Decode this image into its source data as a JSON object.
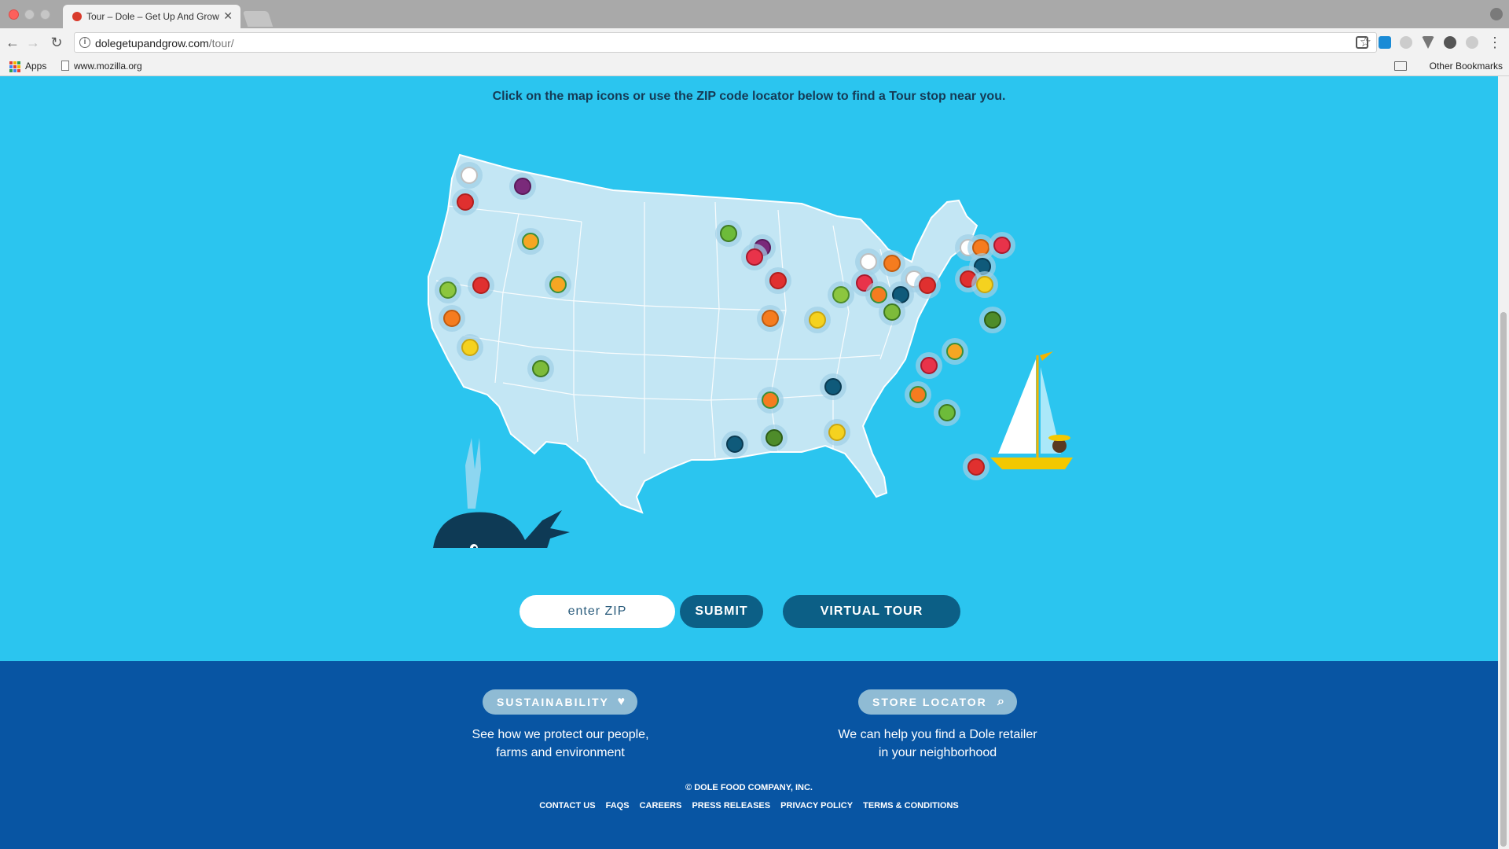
{
  "browser": {
    "tab_title": "Tour – Dole – Get Up And Grow",
    "url_domain": "dolegetupandgrow.com",
    "url_path": "/tour/",
    "bookmarks": {
      "apps": "Apps",
      "mozilla": "www.mozilla.org",
      "other": "Other Bookmarks"
    }
  },
  "main": {
    "instructions": "Click on the map icons or use the ZIP code locator below to find a Tour stop near you.",
    "zip_placeholder": "enter ZIP",
    "submit_label": "SUBMIT",
    "virtual_tour_label": "VIRTUAL TOUR"
  },
  "footer": {
    "sustainability_label": "SUSTAINABILITY",
    "sustainability_text_1": "See how we protect our people,",
    "sustainability_text_2": "farms and environment",
    "store_label": "STORE LOCATOR",
    "store_text_1": "We can help you find a Dole retailer",
    "store_text_2": "in your neighborhood",
    "copyright": "© DOLE FOOD COMPANY, INC.",
    "links": [
      "CONTACT US",
      "FAQS",
      "CAREERS",
      "PRESS RELEASES",
      "PRIVACY POLICY",
      "TERMS & CONDITIONS"
    ]
  },
  "colors": {
    "page_bg": "#2bc5ef",
    "map_land": "#c3e6f4",
    "button": "#0c5f86",
    "footer_bg": "#0855a3",
    "pill": "#8fbbd4"
  },
  "map_markers": [
    {
      "type": "mushroom-icon"
    },
    {
      "type": "grapes-icon"
    },
    {
      "type": "strawberry-icon"
    },
    {
      "type": "pineapple-icon"
    },
    {
      "type": "lettuce-icon"
    },
    {
      "type": "strawberry-icon"
    },
    {
      "type": "orange-icon"
    },
    {
      "type": "banana-icon"
    },
    {
      "type": "pineapple-icon"
    },
    {
      "type": "cucumber-icon"
    },
    {
      "type": "spinach-leaf-icon"
    },
    {
      "type": "grapes-icon"
    },
    {
      "type": "raspberry-icon"
    },
    {
      "type": "strawberry-icon"
    },
    {
      "type": "orange-icon"
    },
    {
      "type": "lettuce-icon"
    },
    {
      "type": "banana-icon"
    },
    {
      "type": "mushroom-icon"
    },
    {
      "type": "raspberry-icon"
    },
    {
      "type": "orange-icon"
    },
    {
      "type": "mushroom-icon"
    },
    {
      "type": "blueberry-icon"
    },
    {
      "type": "cucumber-icon"
    },
    {
      "type": "strawberry-icon"
    },
    {
      "type": "mushroom-icon"
    },
    {
      "type": "orange-icon"
    },
    {
      "type": "raspberry-icon"
    },
    {
      "type": "blueberry-icon"
    },
    {
      "type": "strawberry-icon"
    },
    {
      "type": "banana-icon"
    },
    {
      "type": "carrot-icon"
    },
    {
      "type": "broccoli-icon"
    },
    {
      "type": "pineapple-icon"
    },
    {
      "type": "raspberry-icon"
    },
    {
      "type": "blueberry-icon"
    },
    {
      "type": "carrot-icon"
    },
    {
      "type": "carrot-icon"
    },
    {
      "type": "spinach-leaf-icon"
    },
    {
      "type": "broccoli-icon"
    },
    {
      "type": "blueberry-icon"
    },
    {
      "type": "banana-icon"
    },
    {
      "type": "strawberry-icon"
    }
  ]
}
